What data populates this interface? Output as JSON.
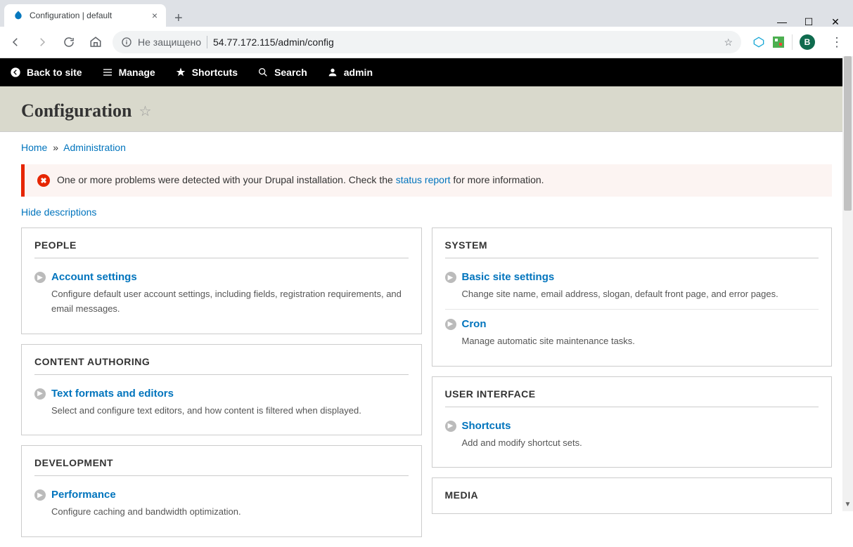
{
  "browser": {
    "tab_title": "Configuration | default",
    "addr_status": "Не защищено",
    "url": "54.77.172.115/admin/config",
    "profile_letter": "B"
  },
  "admin_bar": {
    "back": "Back to site",
    "manage": "Manage",
    "shortcuts": "Shortcuts",
    "search": "Search",
    "user": "admin"
  },
  "page": {
    "title": "Configuration",
    "breadcrumb_home": "Home",
    "breadcrumb_admin": "Administration",
    "error_pre": "One or more problems were detected with your Drupal installation. Check the ",
    "error_link": "status report",
    "error_post": " for more information.",
    "hide_desc": "Hide descriptions"
  },
  "cols": {
    "left": [
      {
        "heading": "PEOPLE",
        "items": [
          {
            "title": "Account settings",
            "desc": "Configure default user account settings, including fields, registration requirements, and email messages."
          }
        ]
      },
      {
        "heading": "CONTENT AUTHORING",
        "items": [
          {
            "title": "Text formats and editors",
            "desc": "Select and configure text editors, and how content is filtered when displayed."
          }
        ]
      },
      {
        "heading": "DEVELOPMENT",
        "items": [
          {
            "title": "Performance",
            "desc": "Configure caching and bandwidth optimization."
          }
        ]
      }
    ],
    "right": [
      {
        "heading": "SYSTEM",
        "items": [
          {
            "title": "Basic site settings",
            "desc": "Change site name, email address, slogan, default front page, and error pages."
          },
          {
            "title": "Cron",
            "desc": "Manage automatic site maintenance tasks."
          }
        ]
      },
      {
        "heading": "USER INTERFACE",
        "items": [
          {
            "title": "Shortcuts",
            "desc": "Add and modify shortcut sets."
          }
        ]
      },
      {
        "heading": "MEDIA",
        "items": []
      }
    ]
  }
}
